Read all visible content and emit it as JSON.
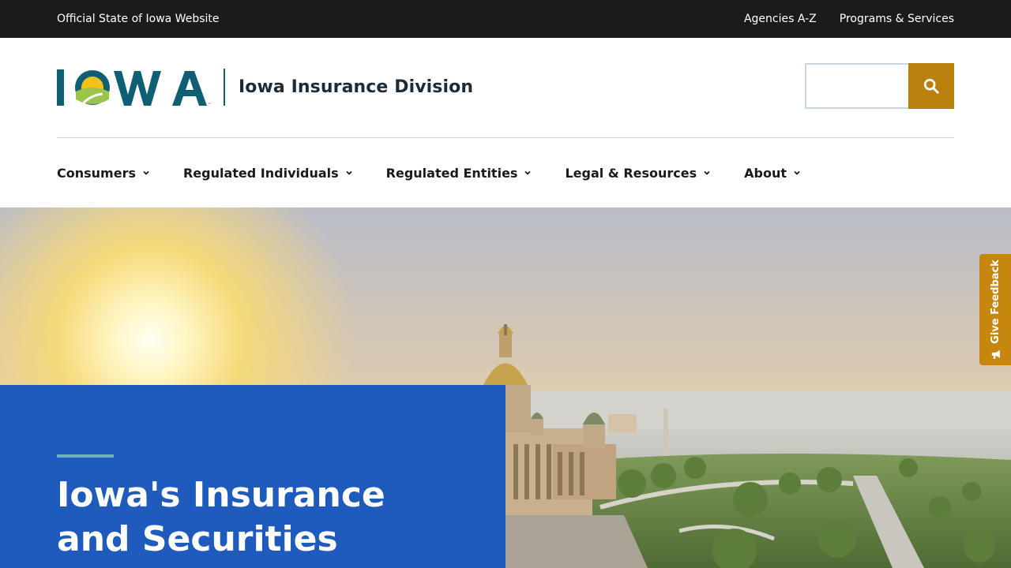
{
  "utility": {
    "official_text": "Official State of Iowa Website",
    "links": [
      "Agencies A-Z",
      "Programs & Services"
    ]
  },
  "header": {
    "logo_text": "IOWA",
    "site_title": "Iowa Insurance Division",
    "search_placeholder": "",
    "search_icon": "search-icon"
  },
  "nav": {
    "items": [
      {
        "label": "Consumers"
      },
      {
        "label": "Regulated Individuals"
      },
      {
        "label": "Regulated Entities"
      },
      {
        "label": "Legal & Resources"
      },
      {
        "label": "About"
      }
    ]
  },
  "hero": {
    "title_line1": "Iowa's Insurance",
    "title_line2": "and Securities"
  },
  "feedback": {
    "label": "Give Feedback"
  },
  "colors": {
    "utility_bar": "#1b1b1b",
    "brand_teal": "#0e5f74",
    "search_button": "#b9810b",
    "hero_card": "#1f5bbd",
    "accent_line": "#6fb3b6",
    "feedback_tab": "#c7870f"
  }
}
